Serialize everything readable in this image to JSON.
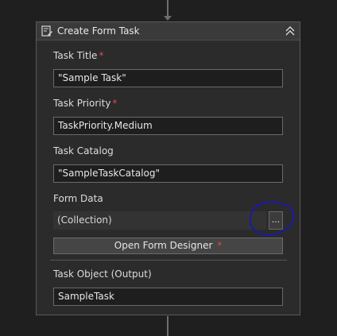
{
  "activity": {
    "title": "Create Form Task",
    "icon": "form-task-icon",
    "collapse_icon": "double-chevron-up-icon"
  },
  "fields": {
    "task_title": {
      "label": "Task Title",
      "required_mark": "*",
      "value": "\"Sample Task\""
    },
    "task_priority": {
      "label": "Task Priority",
      "required_mark": "*",
      "value": "TaskPriority.Medium"
    },
    "task_catalog": {
      "label": "Task Catalog",
      "value": "\"SampleTaskCatalog\""
    },
    "form_data": {
      "label": "Form Data",
      "value": "(Collection)",
      "button_label": "..."
    },
    "task_object": {
      "label": "Task Object (Output)",
      "value": "SampleTask"
    }
  },
  "designer_button": {
    "label": "Open Form Designer",
    "required_mark": "*"
  },
  "colors": {
    "background": "#1f1f1f",
    "panel": "#2b2b2b",
    "required": "#e04646",
    "annotation_circle": "#1a1aa8"
  }
}
